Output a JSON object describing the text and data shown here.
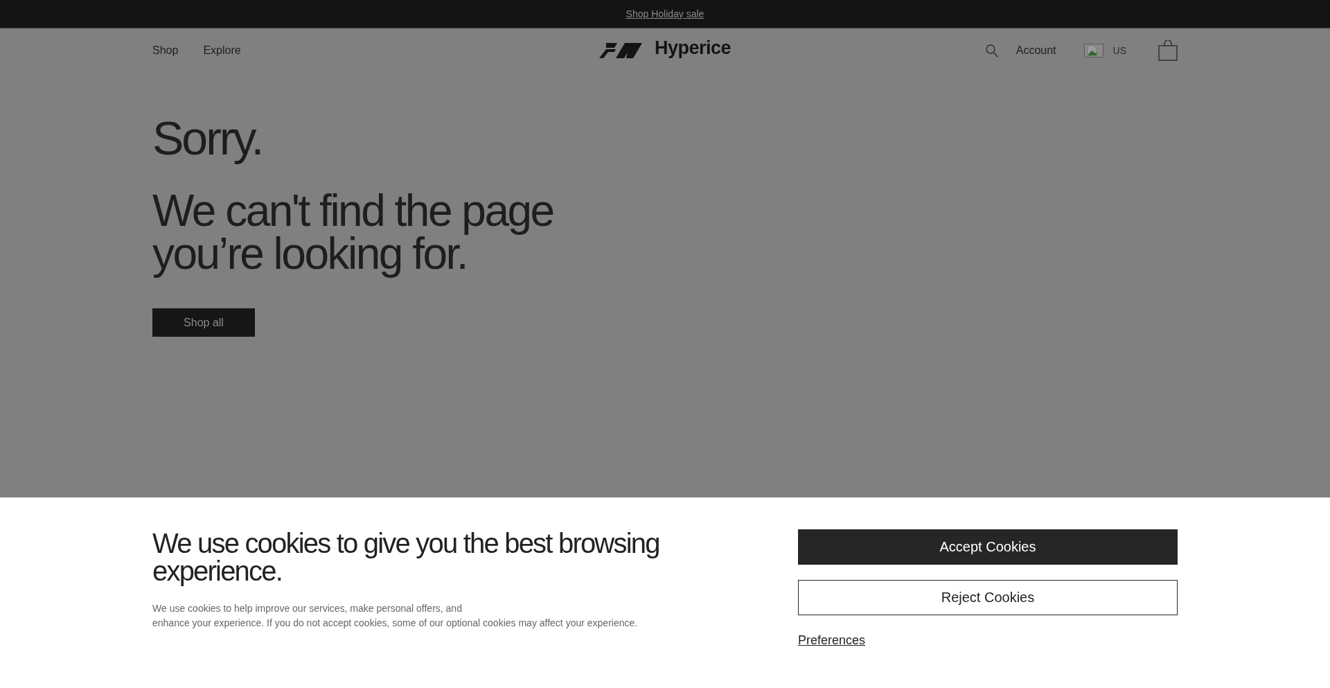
{
  "promo_bar": {
    "link": "Shop Holiday sale"
  },
  "header": {
    "nav": [
      {
        "label": "Shop"
      },
      {
        "label": "Explore"
      }
    ],
    "logo": "Hyperice",
    "account": "Account",
    "region": "US"
  },
  "error": {
    "title": "Sorry.",
    "message": "We can't find the page you’re looking for.",
    "button": "Shop all"
  },
  "cookie_banner": {
    "title": "We use cookies to give you the best browsing experience.",
    "text": "We use cookies to help improve our services, make personal offers, and\nenhance your experience. If you do not accept cookies, some of our optional cookies may affect your experience.",
    "buttons": [
      {
        "label": "Accept Cookies",
        "kind": "primary"
      },
      {
        "label": "Reject Cookies",
        "kind": "outline"
      }
    ],
    "link": "Preferences"
  }
}
